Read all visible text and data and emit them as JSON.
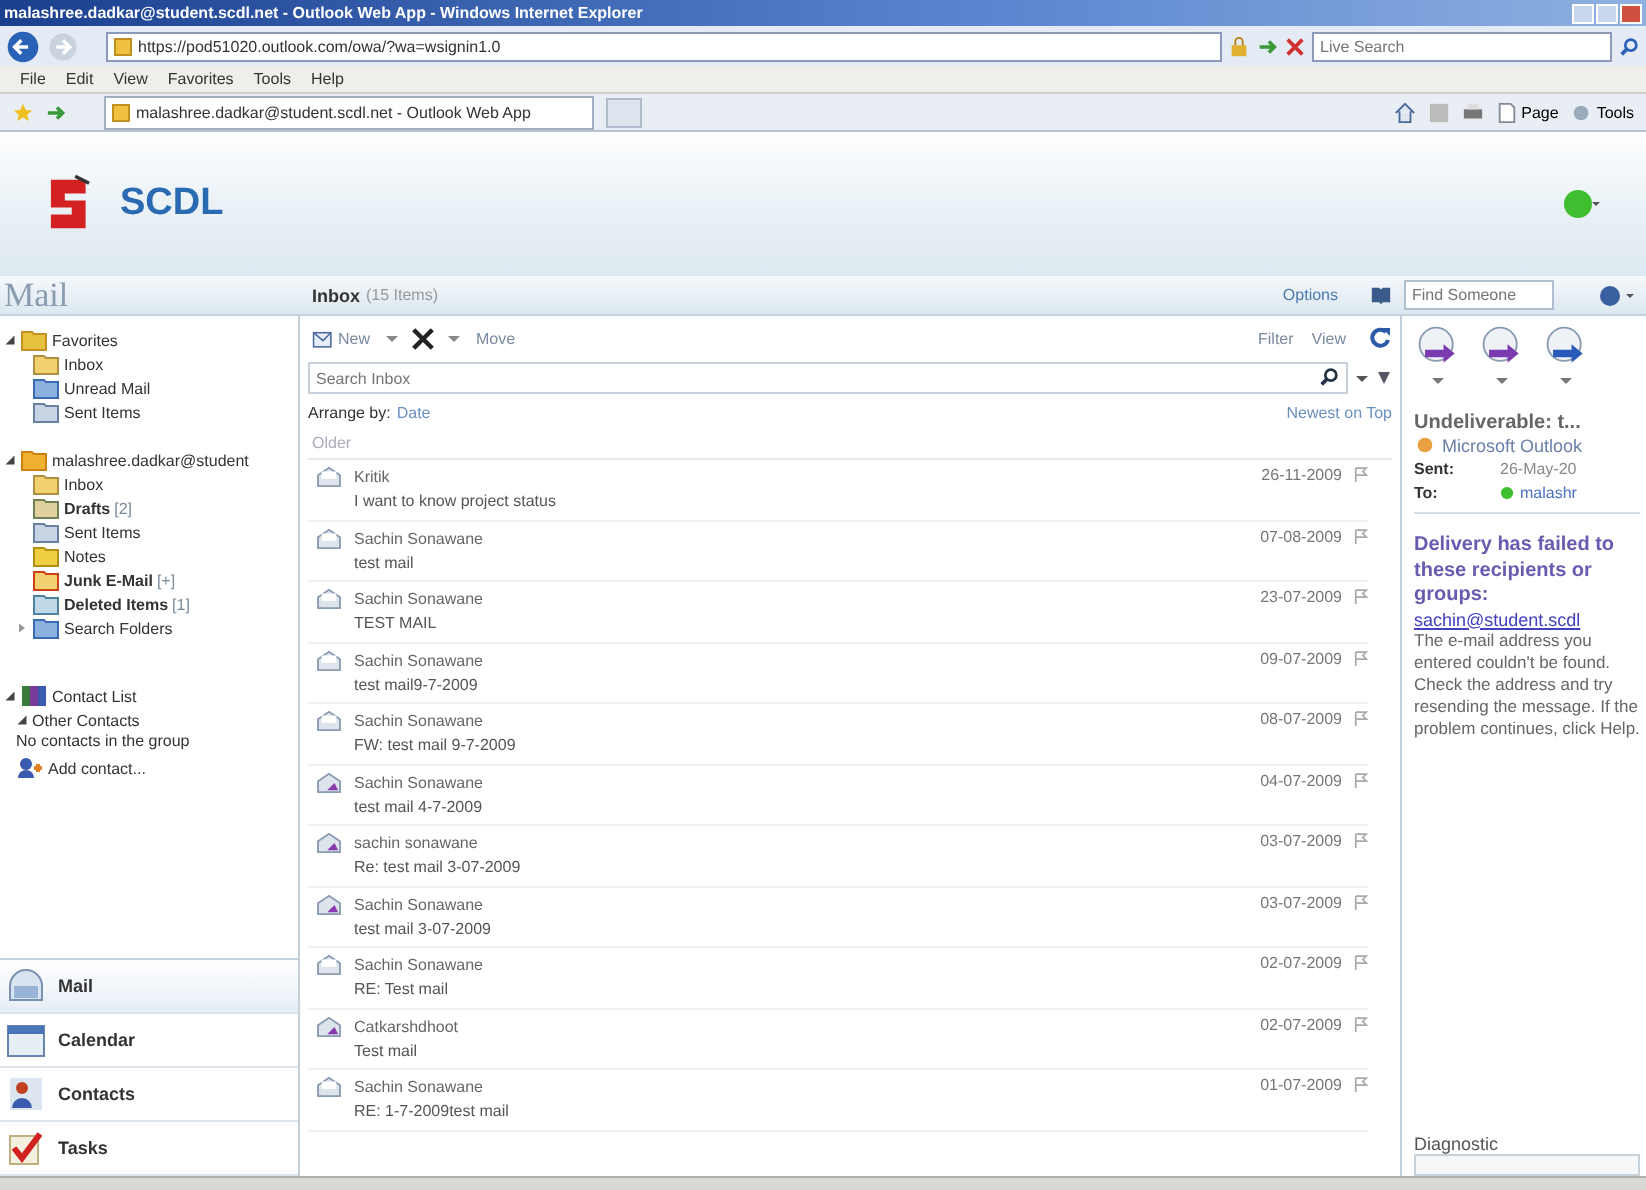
{
  "browser": {
    "title": "malashree.dadkar@student.scdl.net - Outlook Web App - Windows Internet Explorer",
    "address": "https://pod51020.outlook.com/owa/?wa=wsignin1.0",
    "search_placeholder": "Live Search",
    "menu": [
      "File",
      "Edit",
      "View",
      "Favorites",
      "Tools",
      "Help"
    ],
    "tab_title": "malashree.dadkar@student.scdl.net - Outlook Web App",
    "commands": [
      {
        "label": "Page",
        "kind": "page"
      },
      {
        "label": "Tools",
        "kind": "tools"
      }
    ]
  },
  "app": {
    "logo_text": "SCDL"
  },
  "header": {
    "section": "Mail",
    "folder": "Inbox",
    "count": "(15 Items)",
    "options": "Options",
    "find_placeholder": "Find Someone"
  },
  "sidebar": {
    "folders": [
      {
        "label": "Favorites",
        "kind": "star",
        "expanded": true,
        "unread": false,
        "children": [
          {
            "label": "Inbox",
            "kind": "inbox",
            "unread": false
          },
          {
            "label": "Unread Mail",
            "kind": "search",
            "unread": false
          },
          {
            "label": "Sent Items",
            "kind": "sent",
            "unread": false
          }
        ]
      },
      {
        "label": "malashree.dadkar@student",
        "kind": "mailbox",
        "expanded": true,
        "unread": false,
        "children": [
          {
            "label": "Inbox",
            "kind": "inbox",
            "unread": false
          },
          {
            "label": "Drafts",
            "count": "[2]",
            "kind": "drafts",
            "unread": true
          },
          {
            "label": "Sent Items",
            "kind": "sent",
            "unread": false
          },
          {
            "label": "Notes",
            "kind": "notes",
            "unread": false
          },
          {
            "label": "Junk E-Mail",
            "count": "[+]",
            "kind": "junk",
            "unread": true
          },
          {
            "label": "Deleted Items",
            "count": "[1]",
            "kind": "deleted",
            "unread": true
          },
          {
            "label": "Search Folders",
            "kind": "search",
            "expanded": false,
            "unread": false
          }
        ]
      }
    ],
    "contacts": {
      "title": "Contact List",
      "group": "Other Contacts",
      "group_expanded": true,
      "empty": "No contacts in the group",
      "add": "Add contact..."
    },
    "nav": [
      {
        "label": "Mail",
        "kind": "mail",
        "selected": true
      },
      {
        "label": "Calendar",
        "kind": "calendar",
        "selected": false
      },
      {
        "label": "Contacts",
        "kind": "contacts",
        "selected": false
      },
      {
        "label": "Tasks",
        "kind": "tasks",
        "selected": false
      }
    ]
  },
  "toolbar": {
    "new": "New",
    "move": "Move",
    "filter": "Filter",
    "view": "View",
    "search_placeholder": "Search Inbox",
    "arrange_label": "Arrange by:",
    "arrange_value": "Date",
    "sort": "Newest on Top",
    "group": "Older"
  },
  "messages": [
    {
      "sender": "Kritik",
      "subject": "I want to know project status",
      "date": "26-11-2009",
      "kind": "read"
    },
    {
      "sender": "Sachin Sonawane",
      "subject": "test mail",
      "date": "07-08-2009",
      "kind": "read"
    },
    {
      "sender": "Sachin Sonawane",
      "subject": "TEST MAIL",
      "date": "23-07-2009",
      "kind": "read"
    },
    {
      "sender": "Sachin Sonawane",
      "subject": "test mail9-7-2009",
      "date": "09-07-2009",
      "kind": "read"
    },
    {
      "sender": "Sachin Sonawane",
      "subject": "FW: test mail 9-7-2009",
      "date": "08-07-2009",
      "kind": "read"
    },
    {
      "sender": "Sachin Sonawane",
      "subject": "test mail 4-7-2009",
      "date": "04-07-2009",
      "kind": "replied"
    },
    {
      "sender": "sachin sonawane",
      "subject": "Re: test mail 3-07-2009",
      "date": "03-07-2009",
      "kind": "replied"
    },
    {
      "sender": "Sachin Sonawane",
      "subject": "test mail 3-07-2009",
      "date": "03-07-2009",
      "kind": "replied"
    },
    {
      "sender": "Sachin Sonawane",
      "subject": "RE: Test mail",
      "date": "02-07-2009",
      "kind": "read"
    },
    {
      "sender": "Catkarshdhoot",
      "subject": "Test mail",
      "date": "02-07-2009",
      "kind": "replied"
    },
    {
      "sender": "Sachin Sonawane",
      "subject": "RE: 1-7-2009test mail",
      "date": "01-07-2009",
      "kind": "read"
    }
  ],
  "reading": {
    "subject": "Undeliverable: t...",
    "from": "Microsoft Outlook",
    "sent_label": "Sent:",
    "sent": "26-May-20",
    "to_label": "To:",
    "to": "malashr",
    "heading": "Delivery has failed to these recipients or groups:",
    "link": "sachin@student.scdl",
    "body": "The e-mail address you entered couldn't be found. Check the address and try resending the message. If the problem continues, click Help.",
    "footer": "Diagnostic"
  }
}
